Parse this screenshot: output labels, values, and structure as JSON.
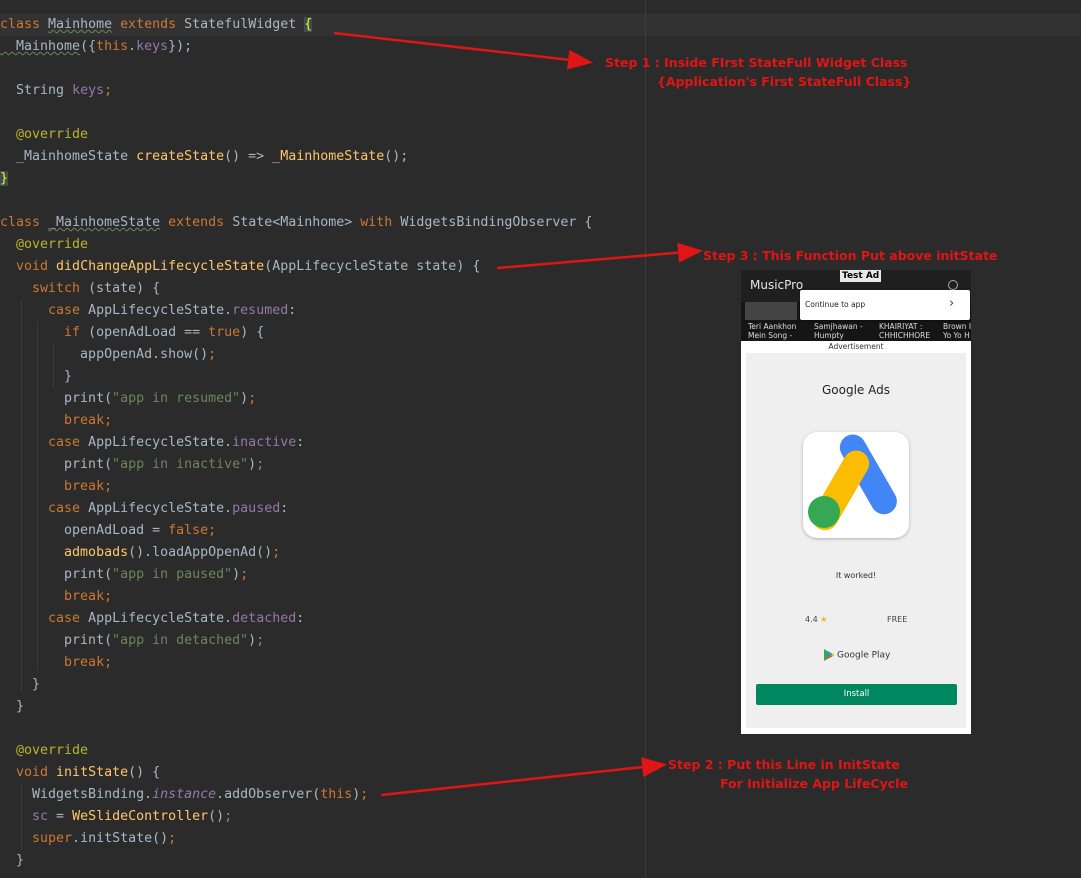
{
  "code_lines": [
    {
      "parts": [
        [
          "kw",
          "class "
        ],
        [
          "cls ul",
          "Mainhome"
        ],
        [
          "kw",
          " extends "
        ],
        [
          "cls",
          "StatefulWidget "
        ],
        [
          "brace",
          "{"
        ]
      ]
    },
    {
      "parts": [
        [
          "cls ul",
          "  Mainhome"
        ],
        [
          "cls",
          "({"
        ],
        [
          "kw",
          "this"
        ],
        [
          "cls",
          "."
        ],
        [
          "prop",
          "keys"
        ],
        [
          "cls",
          "});"
        ]
      ]
    },
    {
      "parts": []
    },
    {
      "parts": [
        [
          "cls",
          "  String "
        ],
        [
          "prop",
          "keys"
        ],
        [
          "kw",
          ";"
        ]
      ]
    },
    {
      "parts": []
    },
    {
      "parts": [
        [
          "ann",
          "  @override"
        ]
      ]
    },
    {
      "parts": [
        [
          "cls",
          "  _MainhomeState "
        ],
        [
          "fn",
          "createState"
        ],
        [
          "cls",
          "() => "
        ],
        [
          "fn",
          "_MainhomeState"
        ],
        [
          "cls",
          "();"
        ]
      ]
    },
    {
      "parts": [
        [
          "brace",
          "}"
        ]
      ]
    },
    {
      "parts": []
    },
    {
      "parts": [
        [
          "kw",
          "class "
        ],
        [
          "cls ul",
          "_MainhomeState"
        ],
        [
          "kw",
          " extends "
        ],
        [
          "cls",
          "State<Mainhome> "
        ],
        [
          "kw",
          "with "
        ],
        [
          "cls",
          "WidgetsBindingObserver {"
        ]
      ]
    },
    {
      "parts": [
        [
          "ann",
          "  @override"
        ]
      ]
    },
    {
      "parts": [
        [
          "kw",
          "  void "
        ],
        [
          "fn",
          "didChangeAppLifecycleState"
        ],
        [
          "cls",
          "(AppLifecycleState state) {"
        ]
      ]
    },
    {
      "parts": [
        [
          "kw",
          "    switch "
        ],
        [
          "cls",
          "(state) {"
        ]
      ]
    },
    {
      "parts": [
        [
          "kw",
          "      case "
        ],
        [
          "cls",
          "AppLifecycleState."
        ],
        [
          "prop",
          "resumed"
        ],
        [
          "cls",
          ":"
        ]
      ]
    },
    {
      "parts": [
        [
          "kw",
          "        if "
        ],
        [
          "cls",
          "(openAdLoad == "
        ],
        [
          "kw",
          "true"
        ],
        [
          "cls",
          ") {"
        ]
      ]
    },
    {
      "parts": [
        [
          "cls",
          "          appOpenAd.show()"
        ],
        [
          "kw",
          ";"
        ]
      ]
    },
    {
      "parts": [
        [
          "cls",
          "        }"
        ]
      ]
    },
    {
      "parts": [
        [
          "cls",
          "        print("
        ],
        [
          "str",
          "\"app in resumed\""
        ],
        [
          "cls",
          ")"
        ],
        [
          "kw",
          ";"
        ]
      ]
    },
    {
      "parts": [
        [
          "kw",
          "        break;"
        ]
      ]
    },
    {
      "parts": [
        [
          "kw",
          "      case "
        ],
        [
          "cls",
          "AppLifecycleState."
        ],
        [
          "prop",
          "inactive"
        ],
        [
          "cls",
          ":"
        ]
      ]
    },
    {
      "parts": [
        [
          "cls",
          "        print("
        ],
        [
          "str",
          "\"app in inactive\""
        ],
        [
          "cls",
          ")"
        ],
        [
          "kw",
          ";"
        ]
      ]
    },
    {
      "parts": [
        [
          "kw",
          "        break;"
        ]
      ]
    },
    {
      "parts": [
        [
          "kw",
          "      case "
        ],
        [
          "cls",
          "AppLifecycleState."
        ],
        [
          "prop",
          "paused"
        ],
        [
          "cls",
          ":"
        ]
      ]
    },
    {
      "parts": [
        [
          "cls",
          "        openAdLoad = "
        ],
        [
          "kw",
          "false;"
        ]
      ]
    },
    {
      "parts": [
        [
          "fn",
          "        admobads"
        ],
        [
          "cls",
          "().loadAppOpenAd()"
        ],
        [
          "kw",
          ";"
        ]
      ]
    },
    {
      "parts": [
        [
          "cls",
          "        print("
        ],
        [
          "str",
          "\"app in paused\""
        ],
        [
          "cls",
          ")"
        ],
        [
          "kw",
          ";"
        ]
      ]
    },
    {
      "parts": [
        [
          "kw",
          "        break;"
        ]
      ]
    },
    {
      "parts": [
        [
          "kw",
          "      case "
        ],
        [
          "cls",
          "AppLifecycleState."
        ],
        [
          "prop",
          "detached"
        ],
        [
          "cls",
          ":"
        ]
      ]
    },
    {
      "parts": [
        [
          "cls",
          "        print("
        ],
        [
          "str",
          "\"app in detached\""
        ],
        [
          "cls",
          ")"
        ],
        [
          "kw",
          ";"
        ]
      ]
    },
    {
      "parts": [
        [
          "kw",
          "        break;"
        ]
      ]
    },
    {
      "parts": [
        [
          "cls",
          "    }"
        ]
      ]
    },
    {
      "parts": [
        [
          "cls",
          "  }"
        ]
      ]
    },
    {
      "parts": []
    },
    {
      "parts": [
        [
          "ann",
          "  @override"
        ]
      ]
    },
    {
      "parts": [
        [
          "kw",
          "  void "
        ],
        [
          "fn",
          "initState"
        ],
        [
          "cls",
          "() {"
        ]
      ]
    },
    {
      "parts": [
        [
          "cls",
          "    WidgetsBinding."
        ],
        [
          "ital",
          "instance"
        ],
        [
          "cls",
          ".addObserver("
        ],
        [
          "kw",
          "this"
        ],
        [
          "cls",
          ")"
        ],
        [
          "kw",
          ";"
        ]
      ]
    },
    {
      "parts": [
        [
          "prop",
          "    sc"
        ],
        [
          "cls",
          " = "
        ],
        [
          "fn",
          "WeSlideController"
        ],
        [
          "cls",
          "()"
        ],
        [
          "kw",
          ";"
        ]
      ]
    },
    {
      "parts": [
        [
          "kw",
          "    super"
        ],
        [
          "cls",
          ".initState()"
        ],
        [
          "kw",
          ";"
        ]
      ]
    },
    {
      "parts": [
        [
          "cls",
          "  }"
        ]
      ]
    }
  ],
  "callouts": {
    "step1_line1": "Step 1 : Inside FIrst StateFull Widget Class",
    "step1_line2": "{Application's First StateFull Class}",
    "step3": "Step 3 : This Function Put above initState",
    "step2_line1": "Step 2 : Put this Line in InitState",
    "step2_line2": "For Initialize App LifeCycle"
  },
  "phone": {
    "app_title": "MusicPro",
    "test_ad": "Test Ad",
    "continue_label": "Continue to app",
    "continue_chevron": "›",
    "thumbs": [
      "Teri Aankhon\nMein Song -",
      "Samjhawan -\nHumpty",
      "KHAIRIYAT :\nCHHICHHORE",
      "Brown I\nYo Yo H"
    ],
    "advertisement": "Advertisement",
    "google_ads": "Google Ads",
    "it_worked": "It worked!",
    "rating": "4.4",
    "star": "★",
    "free": "FREE",
    "google_play": "Google Play",
    "install": "Install"
  },
  "colors": {
    "editor_bg": "#2b2b2b",
    "callout_red": "#e01515",
    "install_green": "#01875f"
  }
}
